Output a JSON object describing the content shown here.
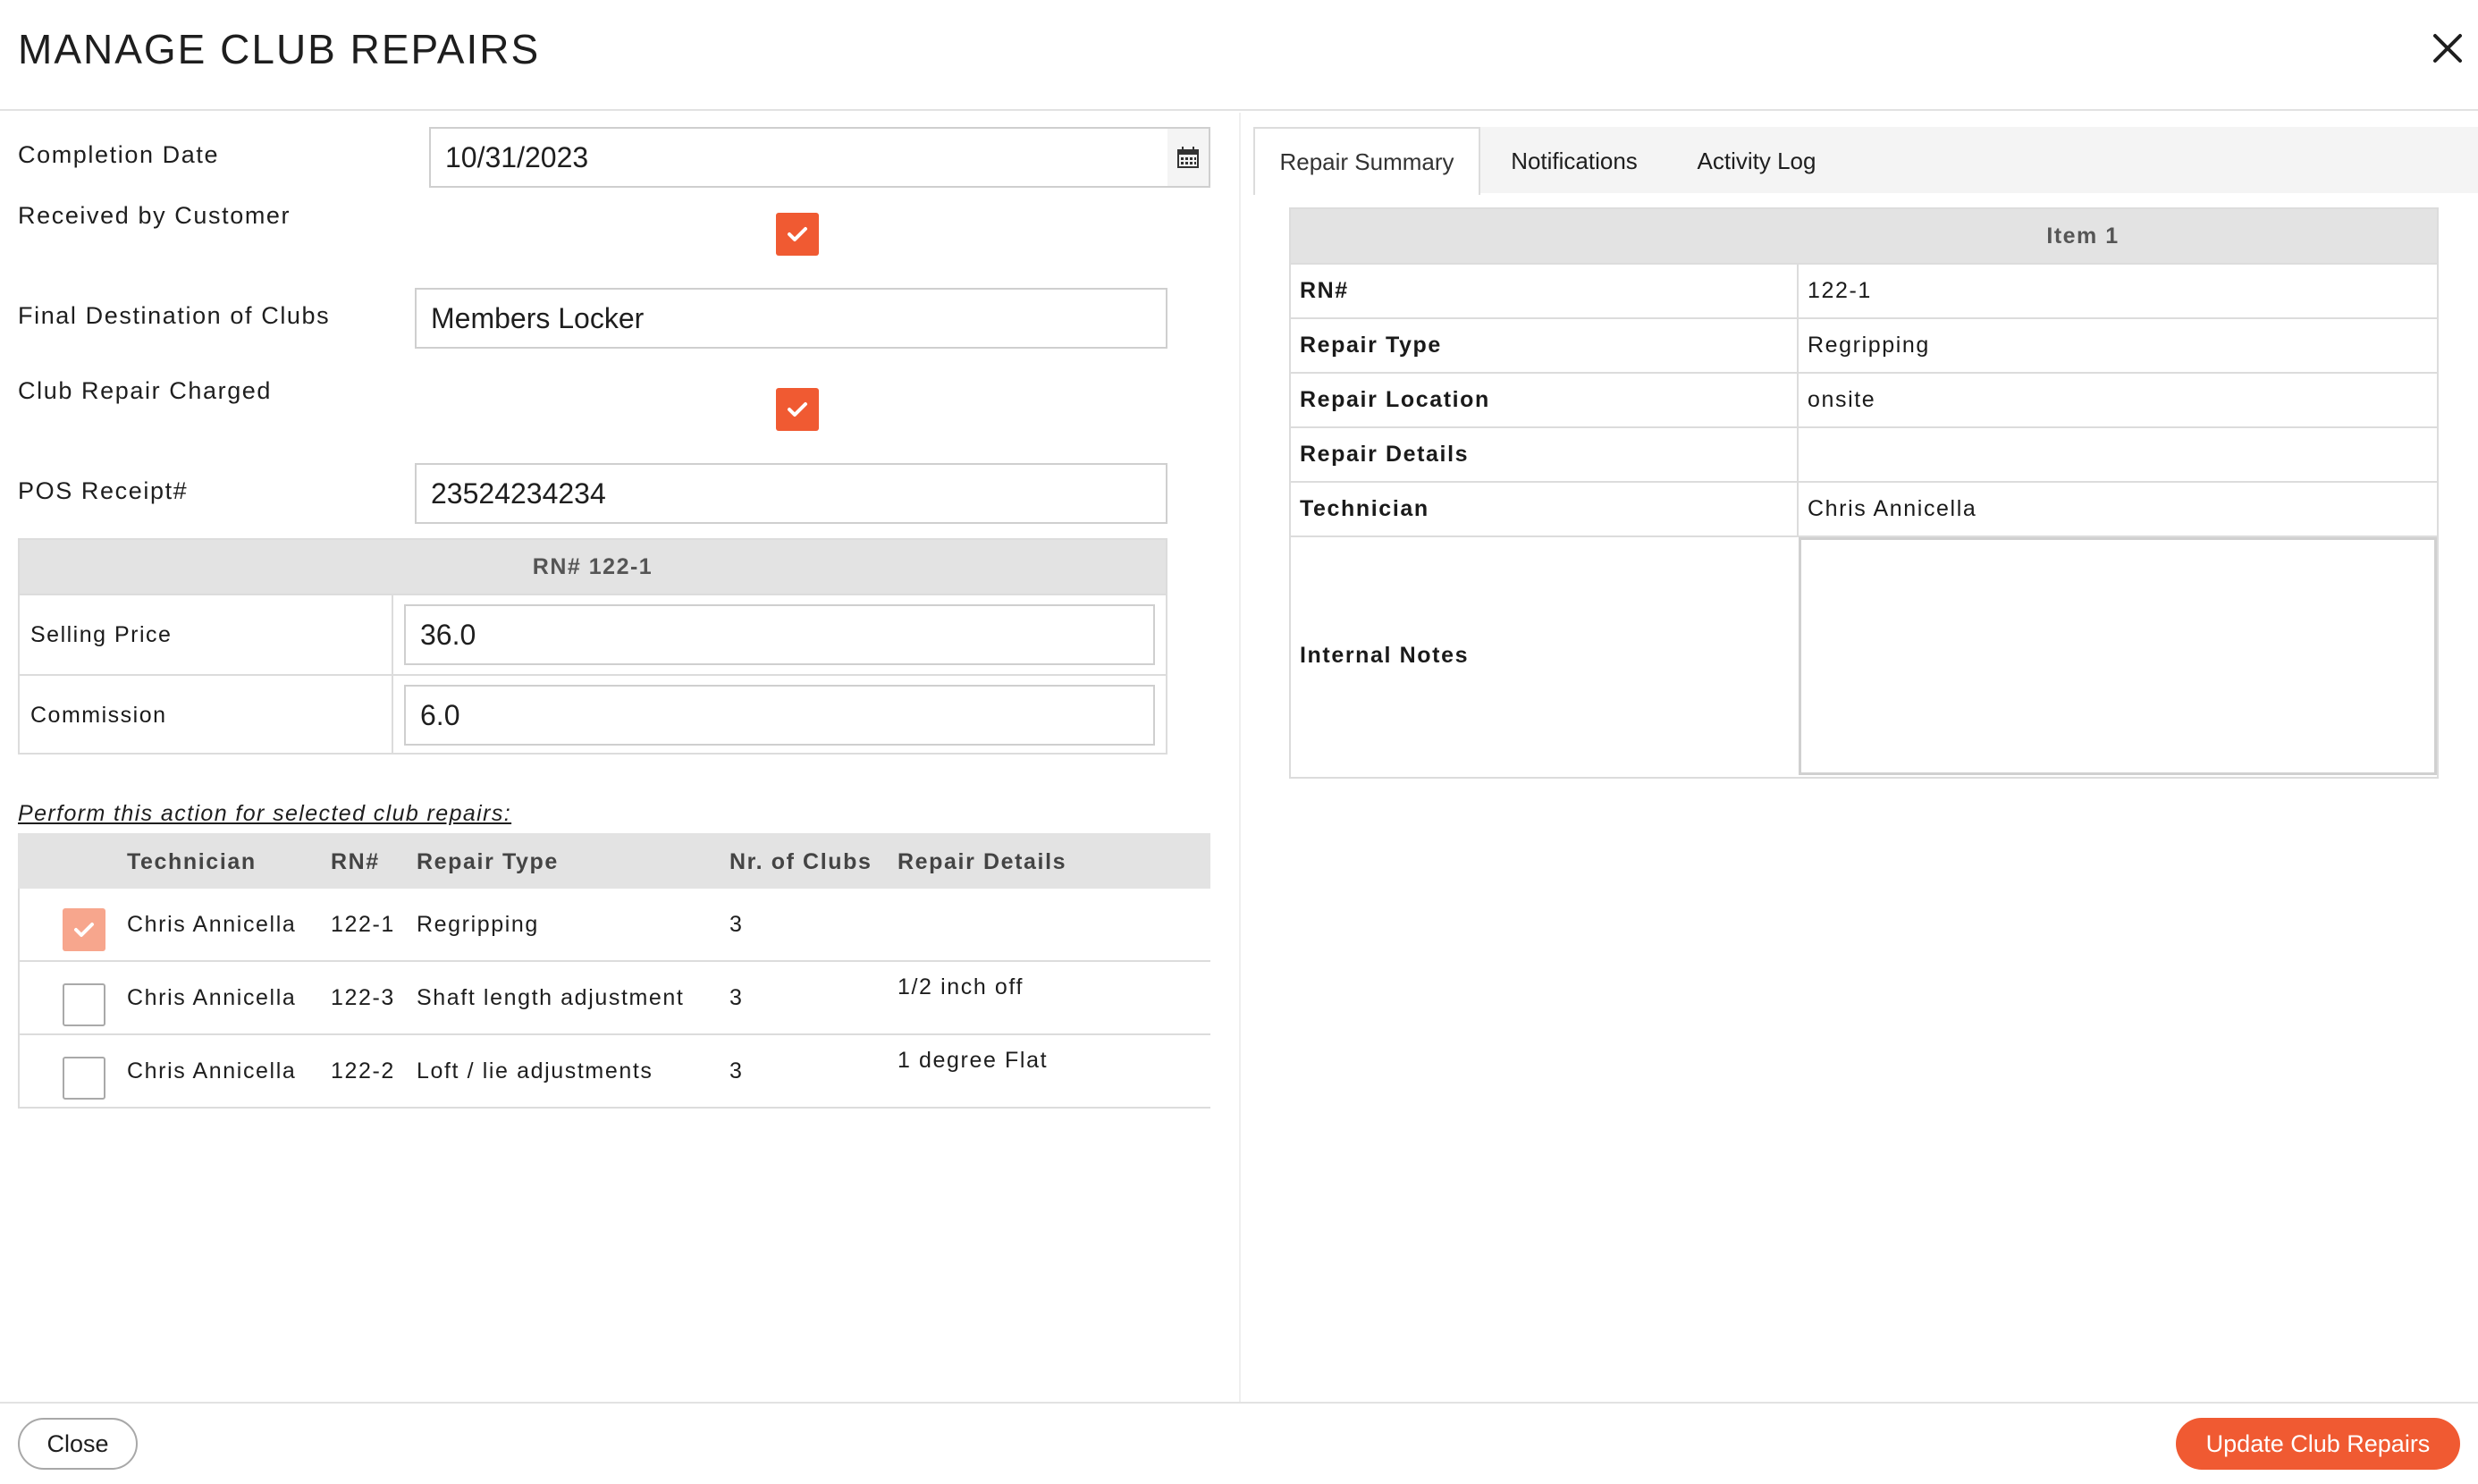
{
  "dialog": {
    "title": "MANAGE CLUB REPAIRS"
  },
  "form": {
    "completion_date_label": "Completion Date",
    "completion_date_value": "10/31/2023",
    "received_by_customer_label": "Received by Customer",
    "received_by_customer_checked": true,
    "final_destination_label": "Final Destination of Clubs",
    "final_destination_value": "Members Locker",
    "club_repair_charged_label": "Club Repair Charged",
    "club_repair_charged_checked": true,
    "pos_receipt_label": "POS Receipt#",
    "pos_receipt_value": "23524234234"
  },
  "rn_section": {
    "header": "RN# 122-1",
    "selling_price_label": "Selling Price",
    "selling_price_value": "36.0",
    "commission_label": "Commission",
    "commission_value": "6.0"
  },
  "action": {
    "label": "Perform this action for selected club repairs:",
    "columns": [
      "Technician",
      "RN#",
      "Repair Type",
      "Nr. of Clubs",
      "Repair Details"
    ],
    "rows": [
      {
        "checked": true,
        "technician": "Chris Annicella",
        "rn": "122-1",
        "repair_type": "Regripping",
        "clubs": "3",
        "details": ""
      },
      {
        "checked": false,
        "technician": "Chris Annicella",
        "rn": "122-3",
        "repair_type": "Shaft length adjustment",
        "clubs": "3",
        "details": "1/2 inch off"
      },
      {
        "checked": false,
        "technician": "Chris Annicella",
        "rn": "122-2",
        "repair_type": "Loft / lie adjustments",
        "clubs": "3",
        "details": "1 degree Flat"
      }
    ]
  },
  "tabs": [
    {
      "label": "Repair Summary",
      "active": true
    },
    {
      "label": "Notifications",
      "active": false
    },
    {
      "label": "Activity Log",
      "active": false
    }
  ],
  "summary": {
    "header": "Item 1",
    "rows": [
      {
        "key": "RN#",
        "value": "122-1"
      },
      {
        "key": "Repair Type",
        "value": "Regripping"
      },
      {
        "key": "Repair Location",
        "value": "onsite"
      },
      {
        "key": "Repair Details",
        "value": ""
      },
      {
        "key": "Technician",
        "value": "Chris Annicella"
      }
    ],
    "internal_notes_label": "Internal Notes",
    "internal_notes_value": ""
  },
  "footer": {
    "close_label": "Close",
    "update_label": "Update Club Repairs"
  },
  "colors": {
    "accent": "#f05a32",
    "accent_light": "#f7a68d",
    "header_bg": "#e3e3e3"
  },
  "icons": {
    "close": "close-icon",
    "calendar": "calendar-icon",
    "check": "checkmark-icon"
  }
}
